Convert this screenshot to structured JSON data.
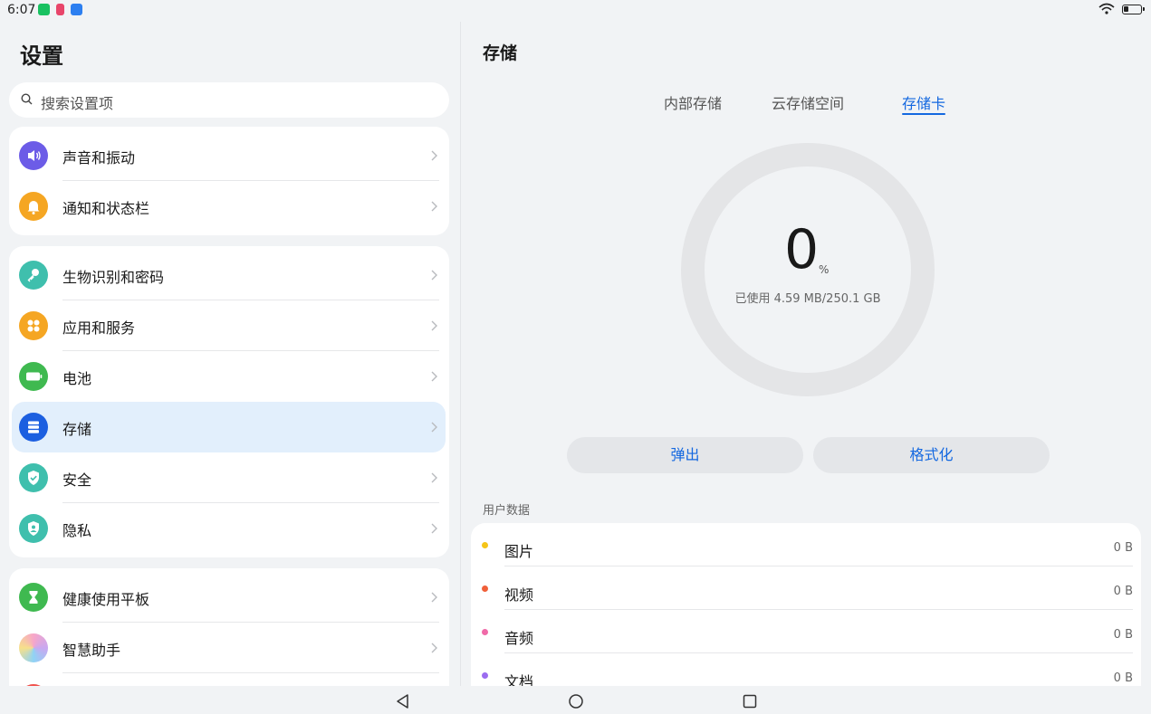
{
  "status_bar": {
    "time": "6:07",
    "notification_icons": [
      "wechat-icon",
      "app-icon",
      "cloud-icon"
    ],
    "wifi_icon": "wifi-icon",
    "battery_icon": "battery-icon"
  },
  "sidebar": {
    "title": "设置",
    "search": {
      "placeholder": "搜索设置项"
    },
    "groups": [
      {
        "items": [
          {
            "label": "声音和振动",
            "icon": "sound-icon",
            "color": "#6c5ce7"
          },
          {
            "label": "通知和状态栏",
            "icon": "bell-icon",
            "color": "#f5a623"
          }
        ]
      },
      {
        "items": [
          {
            "label": "生物识别和密码",
            "icon": "key-icon",
            "color": "#3fbfad"
          },
          {
            "label": "应用和服务",
            "icon": "apps-icon",
            "color": "#f5a623"
          },
          {
            "label": "电池",
            "icon": "battery-icon",
            "color": "#3fb950"
          },
          {
            "label": "存储",
            "icon": "storage-icon",
            "color": "#1c5fe0",
            "selected": true
          },
          {
            "label": "安全",
            "icon": "shield-icon",
            "color": "#3fbfad"
          },
          {
            "label": "隐私",
            "icon": "privacy-icon",
            "color": "#3fbfad"
          }
        ]
      },
      {
        "items": [
          {
            "label": "健康使用平板",
            "icon": "hourglass-icon",
            "color": "#3fb950"
          },
          {
            "label": "智慧助手",
            "icon": "assistant-icon",
            "color": "#c9a8f0"
          }
        ]
      }
    ]
  },
  "main": {
    "title": "存储",
    "tabs": [
      {
        "label": "内部存储",
        "active": false
      },
      {
        "label": "云存储空间",
        "active": false
      },
      {
        "label": "存储卡",
        "active": true
      }
    ],
    "usage": {
      "percent": "0",
      "unit": "%",
      "used_text": "已使用 4.59 MB/250.1 GB"
    },
    "buttons": {
      "eject": "弹出",
      "format": "格式化"
    },
    "section_label": "用户数据",
    "data_items": [
      {
        "label": "图片",
        "value": "0 B",
        "color": "#f5c518"
      },
      {
        "label": "视频",
        "value": "0 B",
        "color": "#f0603a"
      },
      {
        "label": "音频",
        "value": "0 B",
        "color": "#f06aa8"
      },
      {
        "label": "文档",
        "value": "0 B",
        "color": "#9b6cf0"
      }
    ]
  },
  "nav_bar": {
    "back": "back-icon",
    "home": "home-icon",
    "recents": "recents-icon"
  },
  "colors": {
    "accent": "#1468e0",
    "selected_bg": "#e2effc",
    "page_bg": "#f1f3f5"
  }
}
